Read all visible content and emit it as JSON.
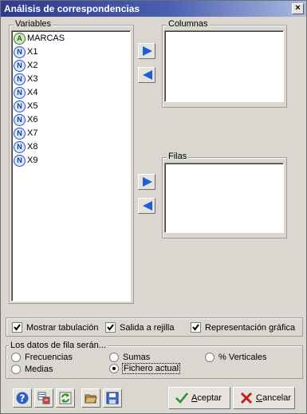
{
  "window": {
    "title": "Análisis de correspondencias",
    "close_glyph": "×"
  },
  "variables": {
    "legend": "Variables",
    "items": [
      {
        "label": "MARCAS",
        "type": "A"
      },
      {
        "label": "X1",
        "type": "N"
      },
      {
        "label": "X2",
        "type": "N"
      },
      {
        "label": "X3",
        "type": "N"
      },
      {
        "label": "X4",
        "type": "N"
      },
      {
        "label": "X5",
        "type": "N"
      },
      {
        "label": "X6",
        "type": "N"
      },
      {
        "label": "X7",
        "type": "N"
      },
      {
        "label": "X8",
        "type": "N"
      },
      {
        "label": "X9",
        "type": "N"
      }
    ]
  },
  "columnas": {
    "legend": "Columnas"
  },
  "filas": {
    "legend": "Filas"
  },
  "options": {
    "mostrar_tabulacion": {
      "label": "Mostrar tabulación",
      "checked": true
    },
    "salida_rejilla": {
      "label": "Salida a rejilla",
      "checked": true
    },
    "representacion_grafica": {
      "label": "Representación gráfica",
      "checked": true
    }
  },
  "row_data": {
    "legend": "Los datos de fila serán...",
    "options": [
      {
        "label": "Frecuencias",
        "selected": false
      },
      {
        "label": "Sumas",
        "selected": false
      },
      {
        "label": "% Verticales",
        "selected": false
      },
      {
        "label": "Medias",
        "selected": false
      },
      {
        "label": "Fichero actual",
        "selected": true
      }
    ]
  },
  "toolbar": {
    "icons": [
      "help-icon",
      "variables-icon",
      "refresh-icon",
      "open-folder-icon",
      "save-disk-icon"
    ]
  },
  "buttons": {
    "accept_accel": "A",
    "accept_rest": "ceptar",
    "cancel_accel": "C",
    "cancel_rest": "ancelar"
  },
  "colors": {
    "title_start": "#2f3a8c",
    "title_end": "#a9bbe0",
    "arrow": "#1f5fd8",
    "check": "#000000",
    "accept_check": "#2e8b2e",
    "cancel_x": "#c02020",
    "dialog_bg": "#dad7d0"
  }
}
